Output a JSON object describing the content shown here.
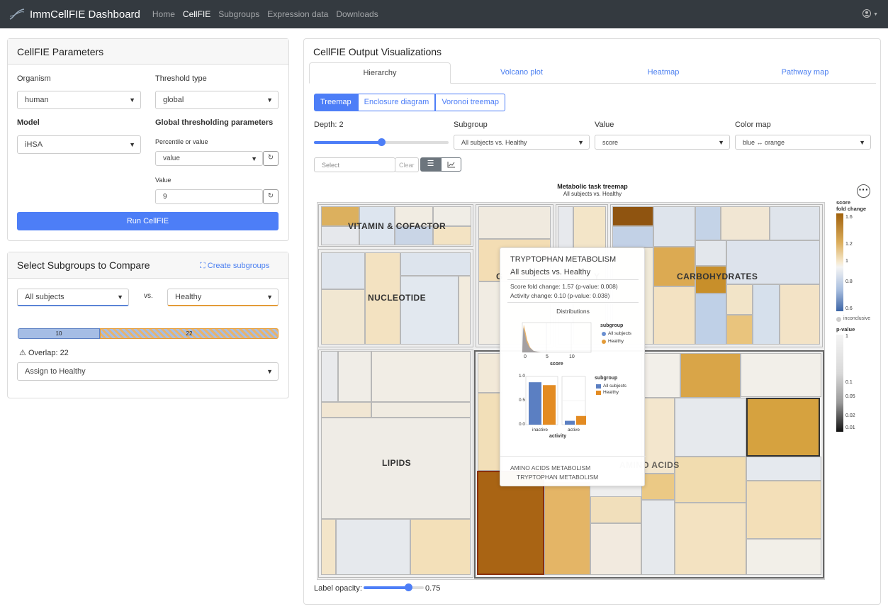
{
  "navbar": {
    "brand": "ImmCellFIE Dashboard",
    "links": [
      "Home",
      "CellFIE",
      "Subgroups",
      "Expression data",
      "Downloads"
    ],
    "active": "CellFIE"
  },
  "params": {
    "title": "CellFIE Parameters",
    "organism_label": "Organism",
    "organism_value": "human",
    "threshold_type_label": "Threshold type",
    "threshold_type_value": "global",
    "model_label": "Model",
    "model_value": "iHSA",
    "global_label": "Global thresholding parameters",
    "percentile_label": "Percentile or value",
    "percentile_value": "value",
    "value_label": "Value",
    "value_value": "9",
    "run_label": "Run CellFIE"
  },
  "subgroups": {
    "title": "Select Subgroups to Compare",
    "create_label": "Create subgroups",
    "left_value": "All subjects",
    "vs_label": "vs.",
    "right_value": "Healthy",
    "bar_left": "10",
    "bar_right": "22",
    "overlap": "Overlap: 22",
    "assign_value": "Assign to Healthy",
    "colors": {
      "left": "#6a8fd0",
      "right": "#e39b38"
    }
  },
  "output": {
    "title": "CellFIE Output Visualizations",
    "tabs": [
      "Hierarchy",
      "Volcano plot",
      "Heatmap",
      "Pathway map"
    ],
    "active_tab": "Hierarchy",
    "view_buttons": [
      "Treemap",
      "Enclosure diagram",
      "Voronoi treemap"
    ],
    "active_view": "Treemap",
    "depth_label": "Depth: 2",
    "depth_value": 2,
    "subgroup_label": "Subgroup",
    "subgroup_value": "All subjects vs. Healthy",
    "value_label": "Value",
    "value_value": "score",
    "colormap_label": "Color map",
    "colormap_value": "blue ↔ orange",
    "select_placeholder": "Select",
    "clear_label": "Clear",
    "label_opacity_label": "Label opacity:",
    "label_opacity_value": "0.75"
  },
  "treemap": {
    "title": "Metabolic task treemap",
    "subtitle": "All subjects vs. Healthy",
    "groups": [
      "VITAMIN & COFACTOR",
      "NUCLEOTIDE",
      "CARBOHYDRATES",
      "LIPIDS",
      "AMINO ACIDS"
    ],
    "covered_group_fragments": [
      "G",
      "Y"
    ]
  },
  "legend": {
    "score_title_1": "score",
    "score_title_2": "fold change",
    "score_ticks": [
      "1.6",
      "1.2",
      "1",
      "0.8",
      "0.6"
    ],
    "inconclusive": "inconclusive",
    "pvalue_title": "p-value",
    "pvalue_ticks": [
      "1",
      "0.1",
      "0.05",
      "0.02",
      "0.01"
    ]
  },
  "tooltip": {
    "title": "TRYPTOPHAN METABOLISM",
    "subtitle": "All subjects vs. Healthy",
    "score_line": "Score fold change: 1.57 (p-value: 0.008)",
    "activity_line": "Activity change: 0.10 (p-value: 0.038)",
    "dist_title": "Distributions",
    "legend_title": "subgroup",
    "legend_items": [
      "All subjects",
      "Healthy"
    ],
    "density_xlabel": "score",
    "density_ticks": [
      "0",
      "5",
      "10"
    ],
    "bar_xlabel": "activity",
    "bar_categories": [
      "inactive",
      "active"
    ],
    "bar_yticks": [
      "1.0",
      "0.5",
      "0.0"
    ],
    "bar_values": {
      "inactive": [
        0.88,
        0.82
      ],
      "active": [
        0.08,
        0.18
      ]
    },
    "footer_1": "AMINO ACIDS METABOLISM",
    "footer_2": "TRYPTOPHAN METABOLISM"
  }
}
